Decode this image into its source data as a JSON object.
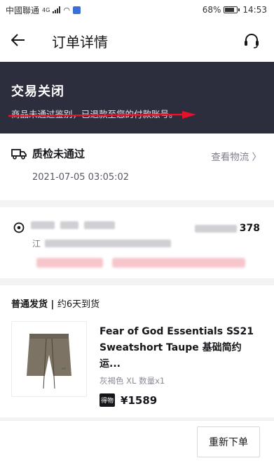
{
  "status_bar": {
    "carrier": "中國聯通",
    "network": "4G",
    "battery": "68%",
    "time": "14:53"
  },
  "nav": {
    "title": "订单详情"
  },
  "banner": {
    "title": "交易关闭",
    "subtitle": "商品未通过鉴别，已退款至您的付款账号。"
  },
  "logistics": {
    "title": "质检未通过",
    "link": "查看物流 〉",
    "time": "2021-07-05 03:05:02"
  },
  "address": {
    "phone_suffix": "378",
    "province_prefix": "江"
  },
  "product": {
    "ship_type": "普通发货",
    "eta": "约6天到货",
    "name": "Fear of God Essentials SS21 Sweatshort Taupe 基础简约运...",
    "spec": "灰褐色 XL 数量x1",
    "badge": "得物",
    "price": "¥1589"
  },
  "footer": {
    "reorder_label": "重新下单"
  },
  "colors": {
    "banner_bg": "#2c2e3d",
    "arrow": "#e8102a"
  }
}
